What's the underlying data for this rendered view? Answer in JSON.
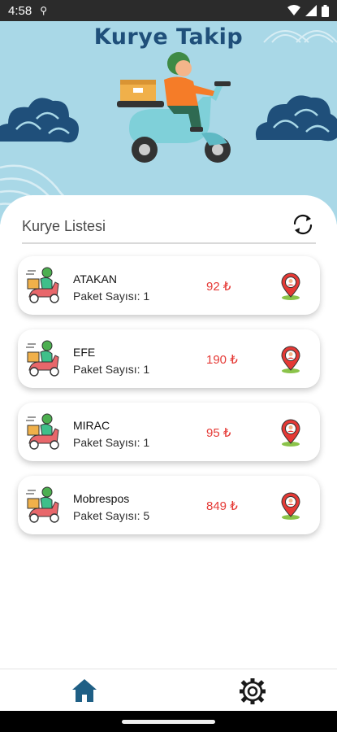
{
  "status_bar": {
    "time": "4:58"
  },
  "header": {
    "title": "Kurye Takip"
  },
  "list": {
    "title": "Kurye Listesi",
    "couriers": [
      {
        "name": "ATAKAN",
        "packages": "Paket Sayısı: 1",
        "price": "92 ₺"
      },
      {
        "name": "EFE",
        "packages": "Paket Sayısı: 1",
        "price": "190 ₺"
      },
      {
        "name": "MIRAC",
        "packages": "Paket Sayısı: 1",
        "price": "95 ₺"
      },
      {
        "name": "Mobrespos",
        "packages": "Paket Sayısı: 5",
        "price": "849 ₺"
      }
    ]
  },
  "colors": {
    "header_bg": "#a9d8e7",
    "title": "#1f4f7a",
    "price": "#e53935",
    "nav_active": "#1f5f85"
  },
  "icons": {
    "refresh": "refresh-icon",
    "location": "location-pin-icon",
    "home": "home-icon",
    "settings": "gear-icon"
  }
}
